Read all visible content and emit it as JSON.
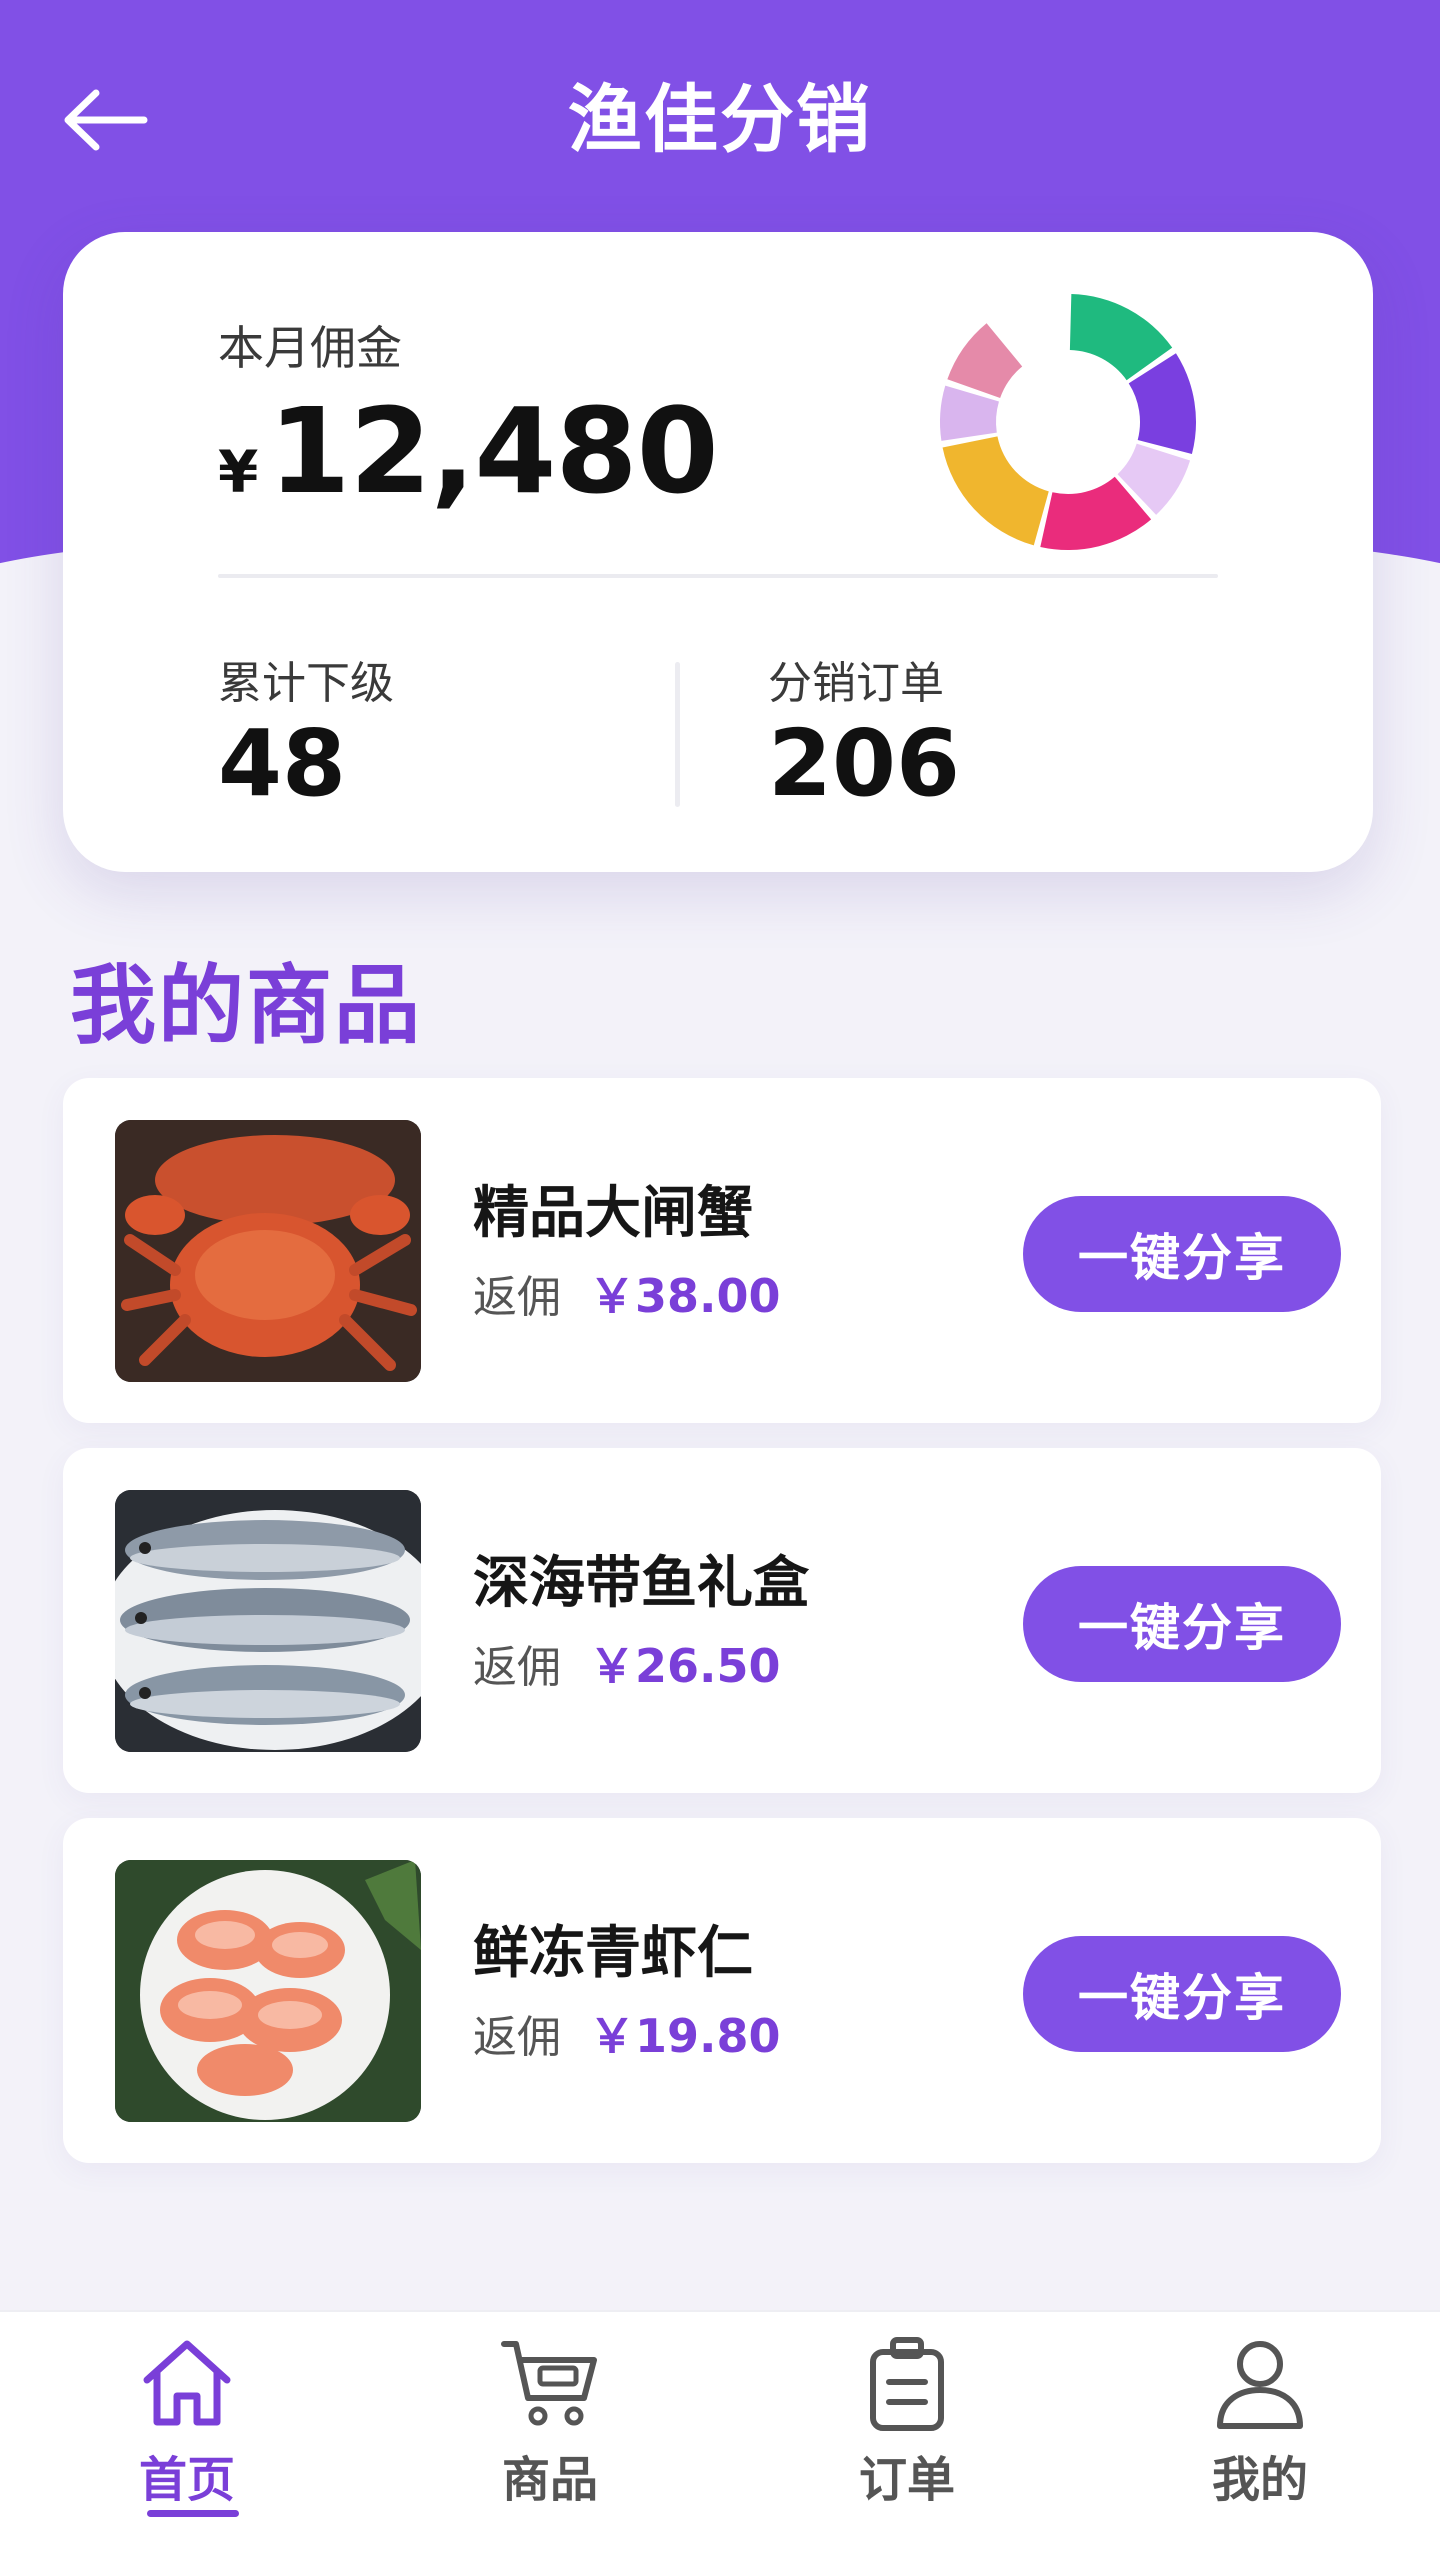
{
  "app_bar": {
    "title": "渔佳分销"
  },
  "stats": {
    "commission_label": "本月佣金",
    "currency": "¥",
    "commission_value": "12,480",
    "subordinates_label": "累计下级",
    "subordinates_value": "48",
    "orders_label": "分销订单",
    "orders_value": "206",
    "donut_colors": [
      "#1fba7f",
      "#7a3fe0",
      "#e6c9f5",
      "#ea2c7c",
      "#f0b62e",
      "#d9b5ee",
      "#e58aa9"
    ]
  },
  "section": {
    "title": "我的商品"
  },
  "products": [
    {
      "name": "精品大闸蟹",
      "rebate_label": "返佣",
      "rebate_value": "￥38.00",
      "share_label": "一键分享",
      "image": "crab-photo"
    },
    {
      "name": "深海带鱼礼盒",
      "rebate_label": "返佣",
      "rebate_value": "￥26.50",
      "share_label": "一键分享",
      "image": "fish-photo"
    },
    {
      "name": "鲜冻青虾仁",
      "rebate_label": "返佣",
      "rebate_value": "￥19.80",
      "share_label": "一键分享",
      "image": "shrimp-photo"
    }
  ],
  "nav": [
    {
      "label": "首页",
      "icon": "home-icon",
      "active": true
    },
    {
      "label": "商品",
      "icon": "cart-icon",
      "active": false
    },
    {
      "label": "订单",
      "icon": "clipboard-icon",
      "active": false
    },
    {
      "label": "我的",
      "icon": "user-icon",
      "active": false
    }
  ],
  "colors": {
    "accent": "#8150e6",
    "accent_text": "#7a3fd8",
    "page_bg": "#f3f2f9"
  }
}
